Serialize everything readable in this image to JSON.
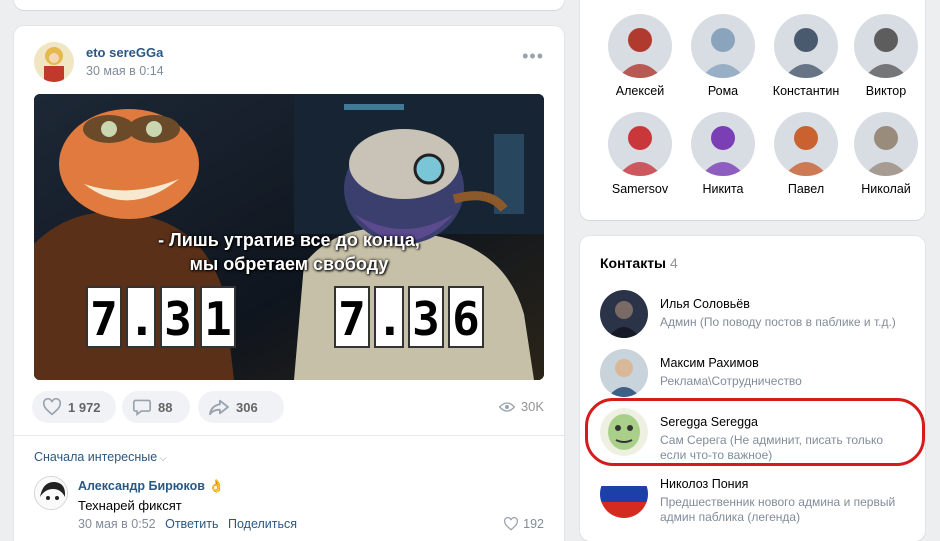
{
  "post": {
    "author": "eto sereGGa",
    "date": "30 мая в 0:14",
    "image": {
      "caption_line1": "- Лишь утратив все до конца,",
      "caption_line2": "мы обретаем свободу",
      "version_left": [
        "7",
        ".",
        "3",
        "1"
      ],
      "version_right": [
        "7",
        ".",
        "3",
        "6"
      ]
    },
    "likes": "1 972",
    "comments": "88",
    "shares": "306",
    "views": "30K"
  },
  "comments_section": {
    "sort_label": "Сначала интересные",
    "comment": {
      "author": "Александр Бирюков",
      "emoji": "👌",
      "text": "Технарей фиксят",
      "date": "30 мая в 0:52",
      "reply_label": "Ответить",
      "share_label": "Поделиться",
      "likes": "192"
    }
  },
  "friends": [
    {
      "name": "Алексей",
      "color": "#b03a2e"
    },
    {
      "name": "Рома",
      "color": "#8aa4be"
    },
    {
      "name": "Константин",
      "color": "#4a5a6e"
    },
    {
      "name": "Виктор",
      "color": "#5d5d5d"
    },
    {
      "name": "Samersov",
      "color": "#c9373b"
    },
    {
      "name": "Никита",
      "color": "#7a3fb5"
    },
    {
      "name": "Павел",
      "color": "#c9622f"
    },
    {
      "name": "Николай",
      "color": "#9a8c7c"
    }
  ],
  "contacts": {
    "title": "Контакты",
    "count": "4",
    "items": [
      {
        "name": "Илья Соловьёв",
        "role": "Админ (По поводу постов в паблике и т.д.)"
      },
      {
        "name": "Максим Рахимов",
        "role": "Реклама\\Сотрудничество"
      },
      {
        "name": "Seregga Seregga",
        "role": "Сам Серега (Не админит, писать только если что-то важное)"
      },
      {
        "name": "Николоз Пония",
        "role": "Предшественник нового админа и первый админ паблика (легенда)"
      }
    ]
  },
  "colors": {
    "link": "#2a5885",
    "secondary": "#818c99",
    "highlight": "#d61b1b",
    "button_bg": "#f0f2f5"
  }
}
